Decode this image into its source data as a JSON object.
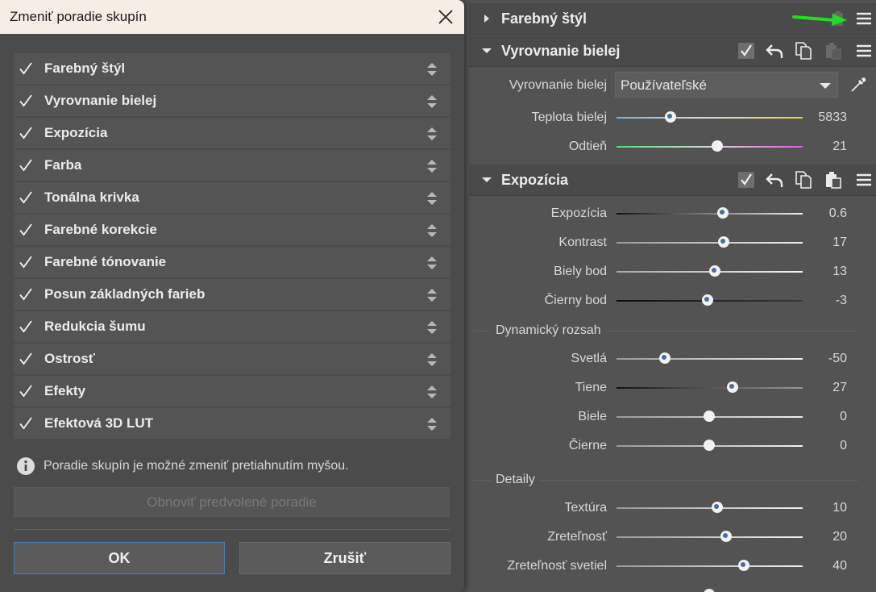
{
  "dialog": {
    "title": "Zmeniť poradie skupín",
    "items": [
      {
        "label": "Farebný štýl",
        "checked": true
      },
      {
        "label": "Vyrovnanie bielej",
        "checked": true
      },
      {
        "label": "Expozícia",
        "checked": true
      },
      {
        "label": "Farba",
        "checked": true
      },
      {
        "label": "Tonálna krivka",
        "checked": true
      },
      {
        "label": "Farebné korekcie",
        "checked": true
      },
      {
        "label": "Farebné tónovanie",
        "checked": true
      },
      {
        "label": "Posun základných farieb",
        "checked": true
      },
      {
        "label": "Redukcia šumu",
        "checked": true
      },
      {
        "label": "Ostrosť",
        "checked": true
      },
      {
        "label": "Efekty",
        "checked": true
      },
      {
        "label": "Efektová 3D LUT",
        "checked": true
      }
    ],
    "info_text": "Poradie skupín je možné zmeniť pretiahnutím myšou.",
    "reset_label": "Obnoviť predvolené poradie",
    "ok_label": "OK",
    "cancel_label": "Zrušiť"
  },
  "panel": {
    "sections": {
      "color_style": {
        "title": "Farebný štýl",
        "expanded": false
      },
      "white_balance": {
        "title": "Vyrovnanie bielej",
        "expanded": true,
        "select_label": "Vyrovnanie bielej",
        "select_value": "Používateľské",
        "sliders": [
          {
            "label": "Teplota bielej",
            "value": "5833",
            "position": 0.29
          },
          {
            "label": "Odtieň",
            "value": "21",
            "position": 0.54
          }
        ]
      },
      "exposure": {
        "title": "Expozícia",
        "expanded": true,
        "sliders": [
          {
            "label": "Expozícia",
            "value": "0.6",
            "position": 0.57
          },
          {
            "label": "Kontrast",
            "value": "17",
            "position": 0.58
          },
          {
            "label": "Biely bod",
            "value": "13",
            "position": 0.53
          },
          {
            "label": "Čierny bod",
            "value": "-3",
            "position": 0.49
          }
        ],
        "dynamic_range": {
          "title": "Dynamický rozsah",
          "sliders": [
            {
              "label": "Svetlá",
              "value": "-50",
              "position": 0.26
            },
            {
              "label": "Tiene",
              "value": "27",
              "position": 0.63
            },
            {
              "label": "Biele",
              "value": "0",
              "position": 0.5
            },
            {
              "label": "Čierne",
              "value": "0",
              "position": 0.5
            }
          ]
        },
        "details": {
          "title": "Detaily",
          "sliders": [
            {
              "label": "Textúra",
              "value": "10",
              "position": 0.55
            },
            {
              "label": "Zreteľnosť",
              "value": "20",
              "position": 0.6
            },
            {
              "label": "Zreteľnosť svetiel",
              "value": "40",
              "position": 0.7
            }
          ]
        }
      }
    }
  },
  "colors": {
    "accent": "#3f6ea8",
    "highlight_arrow": "#22dd22"
  }
}
